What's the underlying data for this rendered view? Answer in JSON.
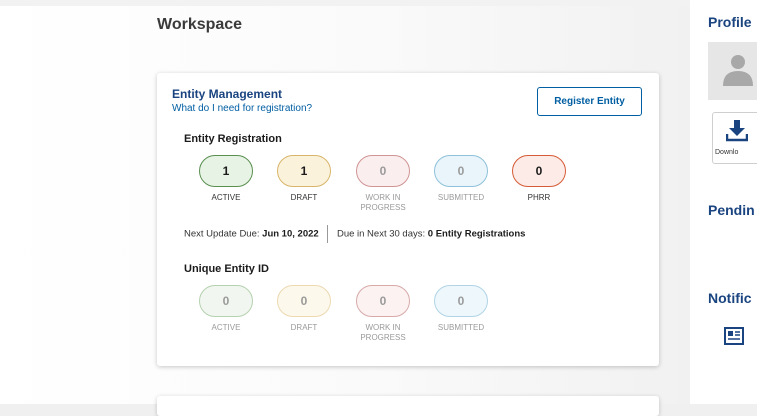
{
  "workspace": {
    "title": "Workspace"
  },
  "entity_card": {
    "title": "Entity Management",
    "help_link": "What do I need for registration?",
    "register_button": "Register Entity",
    "registration": {
      "title": "Entity Registration",
      "statuses": [
        {
          "count": "1",
          "label": "ACTIVE"
        },
        {
          "count": "1",
          "label": "DRAFT"
        },
        {
          "count": "0",
          "label": "WORK IN PROGRESS"
        },
        {
          "count": "0",
          "label": "SUBMITTED"
        },
        {
          "count": "0",
          "label": "PHRR"
        }
      ]
    },
    "next_update": {
      "label": "Next Update Due:",
      "date": "Jun 10, 2022",
      "due_label": "Due in Next 30 days:",
      "due_value": "0 Entity Registrations"
    },
    "uei": {
      "title": "Unique Entity ID",
      "statuses": [
        {
          "count": "0",
          "label": "ACTIVE"
        },
        {
          "count": "0",
          "label": "DRAFT"
        },
        {
          "count": "0",
          "label": "WORK IN PROGRESS"
        },
        {
          "count": "0",
          "label": "SUBMITTED"
        }
      ]
    }
  },
  "sidebar": {
    "profile_title": "Profile",
    "download_label": "Downlo",
    "pending_title": "Pendin",
    "notifications_title": "Notific"
  },
  "colors": {
    "heading_blue": "#1a4480",
    "link_blue": "#005ea2",
    "active_green": "#5a8f50",
    "draft_gold": "#d8b56a",
    "phrr_orange": "#d65b38"
  },
  "icons": [
    "avatar-icon",
    "download-icon",
    "newspaper-icon"
  ]
}
